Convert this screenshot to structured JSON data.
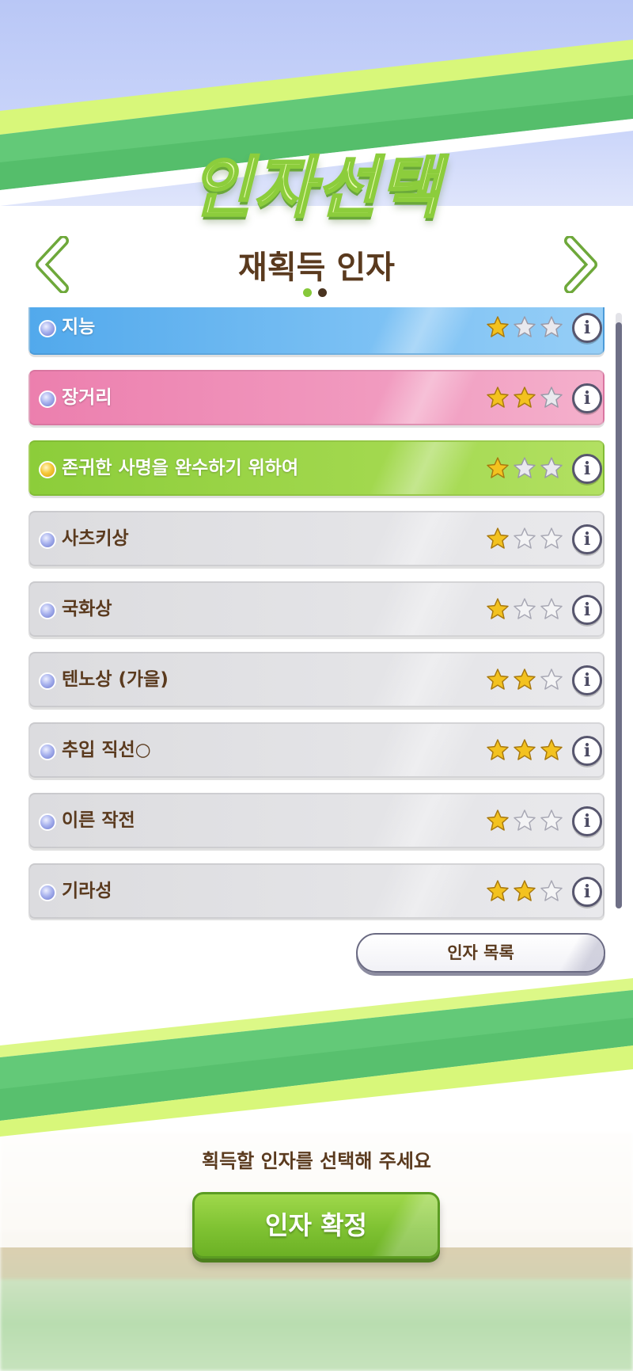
{
  "header": {
    "title": "인자선택",
    "subtitle": "재획득 인자",
    "page_dots": {
      "count": 2,
      "active_index": 0
    }
  },
  "factors": [
    {
      "name": "지능",
      "color": "blue",
      "gem": "blue-gem",
      "stars": 1,
      "max_stars": 3
    },
    {
      "name": "장거리",
      "color": "pink",
      "gem": "blue-gem",
      "stars": 2,
      "max_stars": 3
    },
    {
      "name": "존귀한 사명을 완수하기 위하여",
      "color": "green",
      "gem": "gold-gem",
      "stars": 1,
      "max_stars": 3
    },
    {
      "name": "사츠키상",
      "color": "gray",
      "gem": "blue-gem",
      "stars": 1,
      "max_stars": 3
    },
    {
      "name": "국화상",
      "color": "gray",
      "gem": "blue-gem",
      "stars": 1,
      "max_stars": 3
    },
    {
      "name": "텐노상 (가을)",
      "color": "gray",
      "gem": "blue-gem",
      "stars": 2,
      "max_stars": 3
    },
    {
      "name": "추입 직선○",
      "color": "gray",
      "gem": "blue-gem",
      "stars": 3,
      "max_stars": 3
    },
    {
      "name": "이른 작전",
      "color": "gray",
      "gem": "blue-gem",
      "stars": 1,
      "max_stars": 3
    },
    {
      "name": "기라성",
      "color": "gray",
      "gem": "blue-gem",
      "stars": 2,
      "max_stars": 3
    }
  ],
  "info_button_glyph": "i",
  "buttons": {
    "factor_list": "인자 목록",
    "confirm": "인자 확정"
  },
  "hint": "획득할 인자를 선택해 주세요",
  "colors": {
    "title_fill": "#e9fbb0",
    "title_outline": "#8ccd3c",
    "text_brown": "#5a3a1e",
    "star_filled": "#f3c21f",
    "confirm_green": "#7fc232"
  }
}
